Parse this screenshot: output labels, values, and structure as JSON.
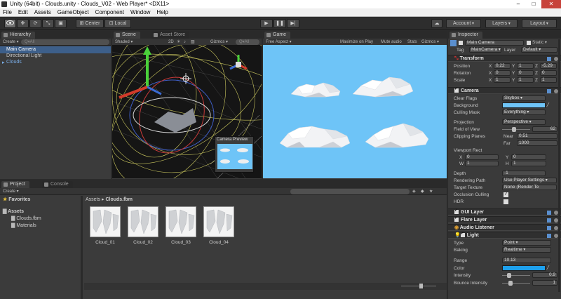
{
  "window": {
    "title": "Unity (64bit) - Clouds.unity - Clouds_V02 - Web Player* <DX11>"
  },
  "menu": [
    "File",
    "Edit",
    "Assets",
    "GameObject",
    "Component",
    "Window",
    "Help"
  ],
  "toolbar": {
    "pivot": "Center",
    "space": "Local",
    "account": "Account",
    "layers": "Layers",
    "layout": "Layout"
  },
  "hierarchy": {
    "tab": "Hierarchy",
    "create": "Create",
    "search_placeholder": "Q▾All",
    "items": [
      "Main Camera",
      "Directional Light",
      "Clouds"
    ]
  },
  "scene": {
    "tabs": [
      "Scene",
      "Asset Store"
    ],
    "shading": "Shaded",
    "mode2d": "2D",
    "gizmos": "Gizmos",
    "search": "Q▾All",
    "preview_title": "Camera Preview"
  },
  "game": {
    "tab": "Game",
    "aspect": "Free Aspect",
    "options": [
      "Maximize on Play",
      "Mute audio",
      "Stats",
      "Gizmos"
    ]
  },
  "inspector": {
    "tab": "Inspector",
    "object_name": "Main Camera",
    "static_label": "Static",
    "tag_label": "Tag",
    "tag_value": "MainCamera",
    "layer_label": "Layer",
    "layer_value": "Default",
    "transform": {
      "title": "Transform",
      "rows": [
        {
          "label": "Position",
          "x": "0.22",
          "y": "1",
          "z": "-5.29"
        },
        {
          "label": "Rotation",
          "x": "0",
          "y": "0",
          "z": "0"
        },
        {
          "label": "Scale",
          "x": "1",
          "y": "1",
          "z": "1"
        }
      ]
    },
    "camera": {
      "title": "Camera",
      "clear_flags_label": "Clear Flags",
      "clear_flags": "Skybox",
      "background_label": "Background",
      "background_color": "#6ec4f7",
      "culling_label": "Culling Mask",
      "culling": "Everything",
      "projection_label": "Projection",
      "projection": "Perspective",
      "fov_label": "Field of View",
      "fov": "62",
      "fov_fraction": 0.34,
      "clipping_label": "Clipping Planes",
      "near_label": "Near",
      "near": "0.51",
      "far_label": "Far",
      "far": "1000",
      "viewport_label": "Viewport Rect",
      "vx_label": "X",
      "vx": "0",
      "vy_label": "Y",
      "vy": "0",
      "vw_label": "W",
      "vw": "1",
      "vh_label": "H",
      "vh": "1",
      "depth_label": "Depth",
      "depth": "-1",
      "render_path_label": "Rendering Path",
      "render_path": "Use Player Settings",
      "target_tex_label": "Target Texture",
      "target_tex": "None (Render Te",
      "occlusion_label": "Occlusion Culling",
      "hdr_label": "HDR"
    },
    "components": [
      "GUI Layer",
      "Flare Layer",
      "Audio Listener"
    ],
    "light": {
      "title": "Light",
      "type_label": "Type",
      "type": "Point",
      "baking_label": "Baking",
      "baking": "Realtime",
      "range_label": "Range",
      "range": "10.13",
      "color_label": "Color",
      "color": "#1ea0ec",
      "intensity_label": "Intensity",
      "intensity": "0.9",
      "bounce_label": "Bounce Intensity",
      "bounce": "1"
    }
  },
  "project": {
    "tabs": [
      "Project",
      "Console"
    ],
    "create": "Create",
    "favorites": "Favorites",
    "assets": "Assets",
    "folders": [
      "Clouds.fbm",
      "Materials"
    ],
    "breadcrumb_root": "Assets",
    "breadcrumb_sep": "▸",
    "breadcrumb_leaf": "Clouds.fbm",
    "files": [
      "Cloud_01",
      "Cloud_02",
      "Cloud_03",
      "Cloud_04"
    ]
  },
  "colors": {
    "accent": "#3d6fa8",
    "sky": "#6ec4f7"
  }
}
